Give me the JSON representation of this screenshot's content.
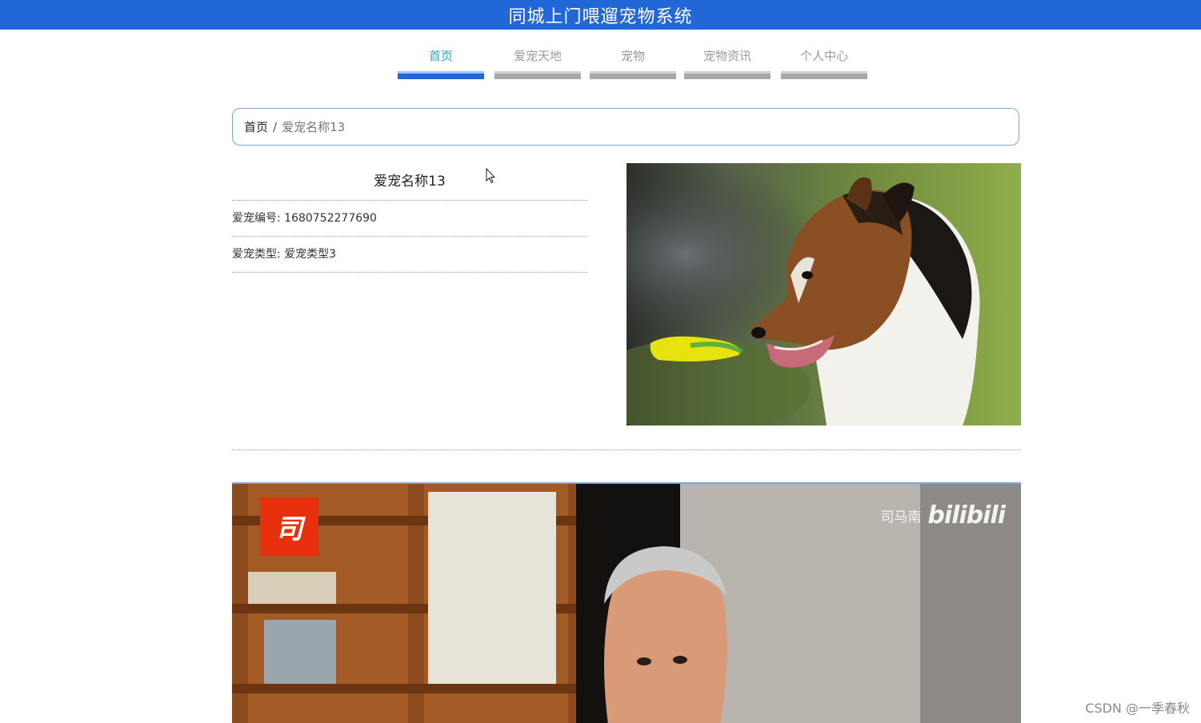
{
  "header": {
    "title": "同城上门喂遛宠物系统"
  },
  "nav": [
    {
      "label": "首页",
      "active": true
    },
    {
      "label": "爱宠天地",
      "active": false
    },
    {
      "label": "宠物",
      "active": false
    },
    {
      "label": "宠物资讯",
      "active": false
    },
    {
      "label": "个人中心",
      "active": false
    }
  ],
  "breadcrumb": {
    "home": "首页",
    "separator": "/",
    "current": "爱宠名称13"
  },
  "pet": {
    "name": "爱宠名称13",
    "id_label": "爱宠编号:",
    "id_value": "1680752277690",
    "type_label": "爱宠类型:",
    "type_value": "爱宠类型3"
  },
  "video": {
    "watermark_name": "司马南",
    "watermark_brand": "bilibili",
    "badge": "司"
  },
  "footer_watermark": "CSDN @一季春秋",
  "colors": {
    "brand": "#2167d7",
    "active_tab_text": "#2aa6c9"
  }
}
